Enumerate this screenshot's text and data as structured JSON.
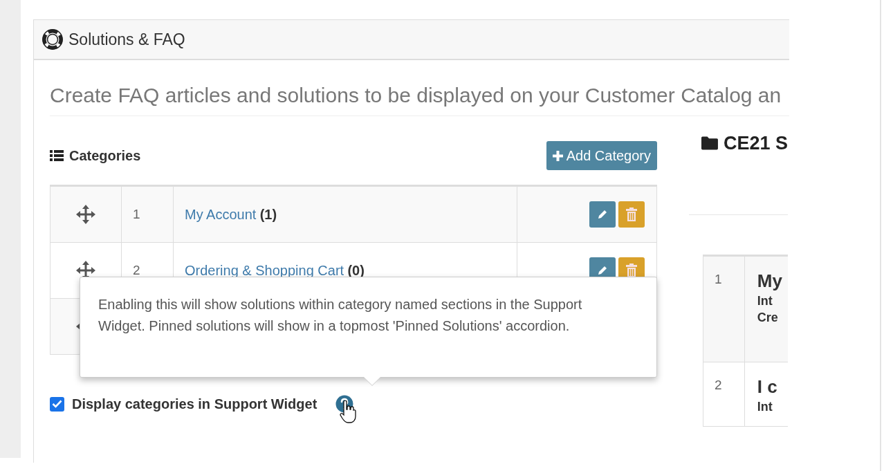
{
  "panel": {
    "title": "Solutions & FAQ",
    "description": "Create FAQ articles and solutions to be displayed on your Customer Catalog an"
  },
  "categories": {
    "heading": "Categories",
    "add_button": "Add Category",
    "rows": [
      {
        "number": "1",
        "name": "My Account",
        "count": "(1)"
      },
      {
        "number": "2",
        "name": "Ordering & Shopping Cart",
        "count": "(0)"
      }
    ]
  },
  "display_option": {
    "label": "Display categories in Support Widget",
    "checked": true
  },
  "tooltip": {
    "text": "Enabling this will show solutions within category named sections in the Support Widget. Pinned solutions will show in a topmost 'Pinned Solutions' accordion."
  },
  "solutions": {
    "heading": "CE21 S",
    "rows": [
      {
        "number": "1",
        "lines": [
          "My",
          "Int",
          "Cre"
        ]
      },
      {
        "number": "2",
        "lines": [
          "I c",
          "Int"
        ]
      }
    ]
  }
}
